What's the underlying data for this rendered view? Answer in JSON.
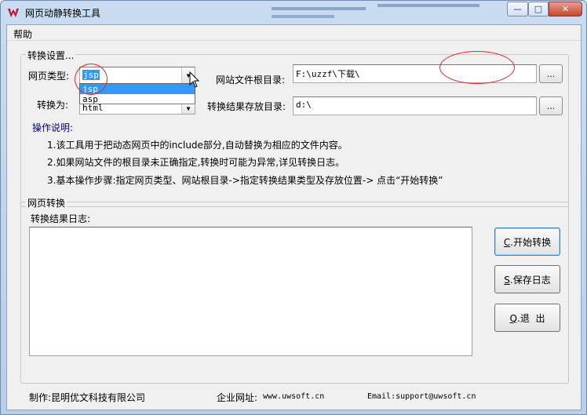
{
  "window": {
    "title": "网页动静转换工具",
    "controls": [
      "minimize",
      "maximize",
      "close"
    ]
  },
  "menu": {
    "items": [
      "帮助"
    ]
  },
  "settings": {
    "legend": "转换设置...",
    "page_type_label": "网页类型:",
    "page_type_value": "jsp",
    "page_type_options": [
      "jsp",
      "asp"
    ],
    "convert_to_label": "转换为:",
    "convert_to_value": "html",
    "site_root_label": "网站文件根目录:",
    "site_root_value": "F:\\uzzf\\下载\\",
    "output_dir_label": "转换结果存放目录:",
    "output_dir_value": "d:\\",
    "browse_label": "...",
    "help_title": "操作说明:",
    "help_lines": [
      "1.该工具用于把动态网页中的include部分,自动替换为相应的文件内容。",
      "2.如果网站文件的根目录未正确指定,转换时可能为异常,详见转换日志。",
      "3.基本操作步骤:指定网页类型、网站根目录->指定转换结果类型及存放位置-> 点击“开始转换”"
    ]
  },
  "convert": {
    "legend": "网页转换",
    "log_label": "转换结果日志:",
    "log_text": "",
    "buttons": {
      "start": {
        "hotkey": "C",
        "label": ".开始转换"
      },
      "save_log": {
        "hotkey": "S",
        "label": ".保存日志"
      },
      "exit": {
        "hotkey": "Q",
        "label": ".退  出"
      }
    }
  },
  "footer": {
    "maker": "制作:昆明优文科技有限公司",
    "site_label": "企业网址:",
    "site_value": "www.uwsoft.cn",
    "email": "Email:support@uwsoft.cn"
  },
  "colors": {
    "help_title": "#00008b",
    "selection": "#3399ff",
    "annotation": "#e0262a",
    "close_button": "#c7462d"
  }
}
